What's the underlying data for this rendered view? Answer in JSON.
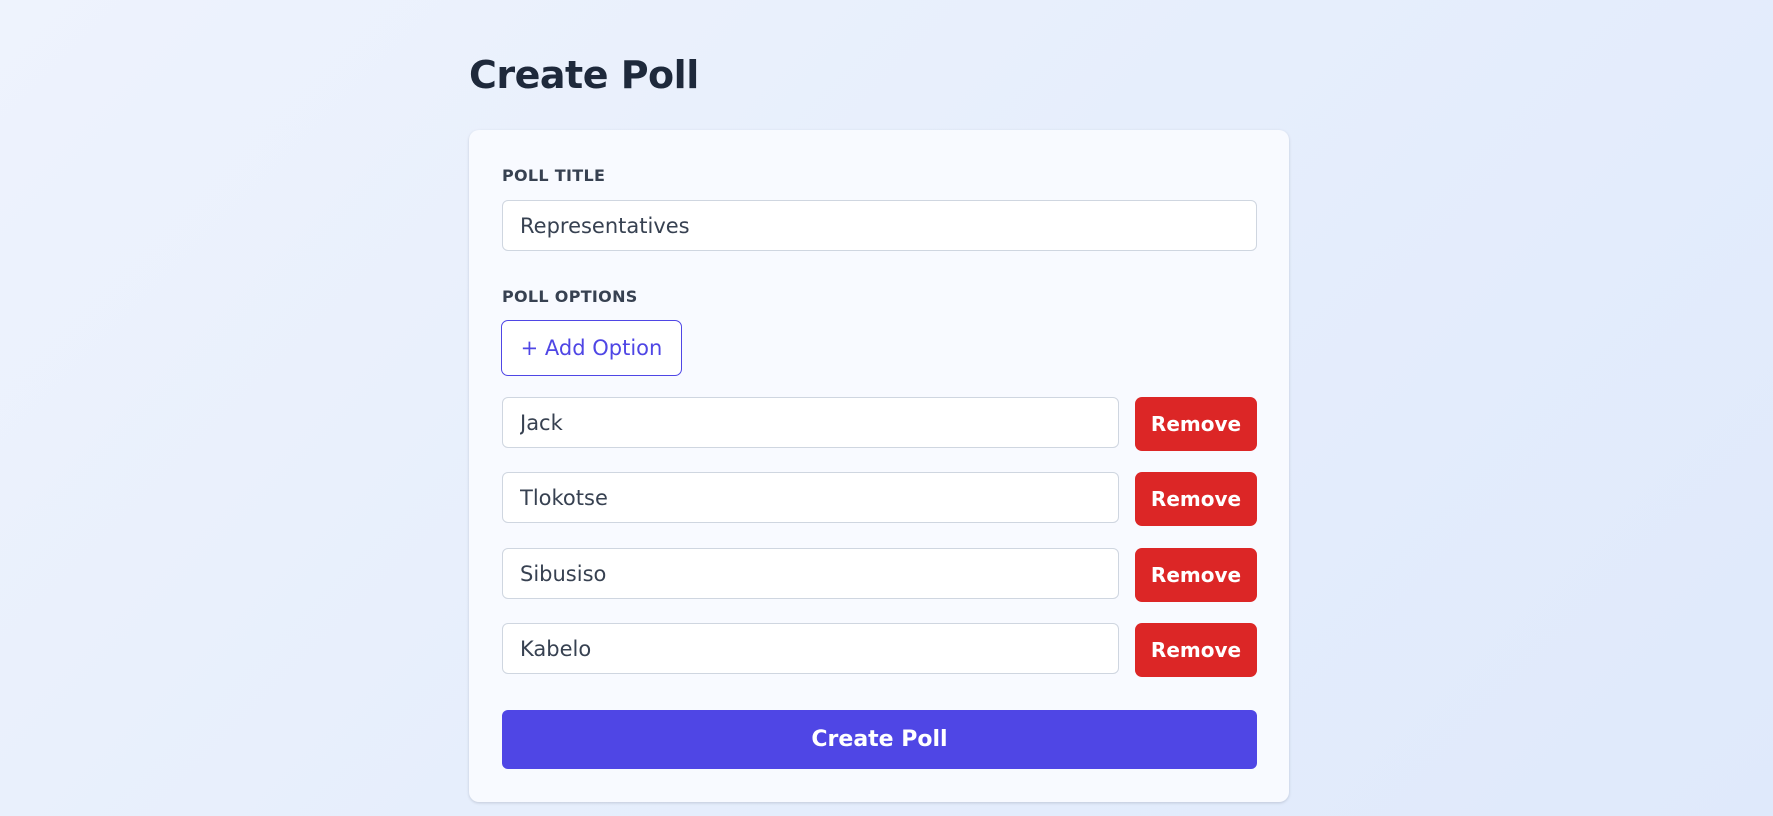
{
  "header": {
    "title": "Create Poll"
  },
  "form": {
    "title_label": "POLL TITLE",
    "title_value": "Representatives",
    "options_label": "POLL OPTIONS",
    "add_option_label": "+ Add Option",
    "options": [
      {
        "value": "Jack",
        "remove_label": "Remove"
      },
      {
        "value": "Tlokotse",
        "remove_label": "Remove"
      },
      {
        "value": "Sibusiso",
        "remove_label": "Remove"
      },
      {
        "value": "Kabelo",
        "remove_label": "Remove"
      }
    ],
    "submit_label": "Create Poll"
  },
  "colors": {
    "primary": "#4f46e5",
    "danger": "#dc2626",
    "heading": "#1e293b",
    "card": "#f8faff"
  }
}
